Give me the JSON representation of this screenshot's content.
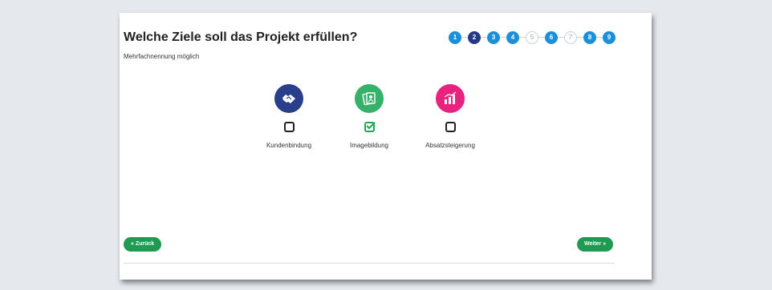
{
  "page": {
    "title": "Welche Ziele soll das Projekt erfüllen?",
    "subtitle": "Mehrfachnennung möglich"
  },
  "progress": {
    "current_step": 2,
    "steps": [
      {
        "label": "1",
        "state": "done"
      },
      {
        "label": "2",
        "state": "current"
      },
      {
        "label": "3",
        "state": "done"
      },
      {
        "label": "4",
        "state": "done"
      },
      {
        "label": "5",
        "state": "todo"
      },
      {
        "label": "6",
        "state": "done"
      },
      {
        "label": "7",
        "state": "todo"
      },
      {
        "label": "8",
        "state": "done"
      },
      {
        "label": "9",
        "state": "done"
      }
    ]
  },
  "options": [
    {
      "label": "Kundenbindung",
      "icon": "handshake-icon",
      "color": "#2a3f8c",
      "checked": false
    },
    {
      "label": "Imagebildung",
      "icon": "image-cards-icon",
      "color": "#37b16a",
      "checked": true
    },
    {
      "label": "Absatzsteigerung",
      "icon": "bar-chart-icon",
      "color": "#e8227f",
      "checked": false
    }
  ],
  "nav": {
    "back_label": "« Zurück",
    "next_label": "Weiter »"
  },
  "colors": {
    "primary_button": "#1f9a52",
    "step_done": "#1d8fd8",
    "step_current": "#243a87"
  }
}
